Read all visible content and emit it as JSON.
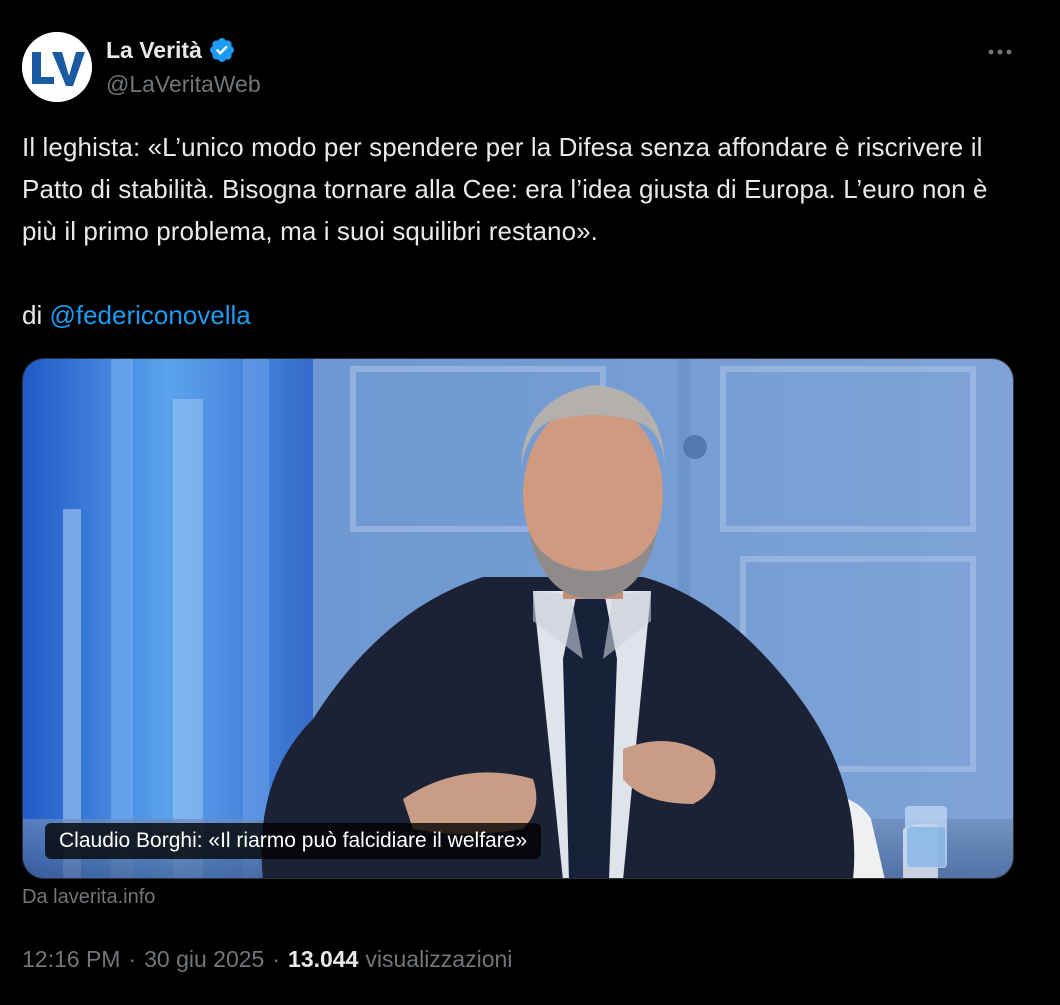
{
  "author": {
    "display_name": "La Verità",
    "handle": "@LaVeritaWeb",
    "avatar_text": "LV",
    "verified": true
  },
  "tweet": {
    "text": "Il leghista: «L’unico modo per spendere per la Difesa senza affondare è riscrivere il Patto di stabilità. Bisogna tornare alla Cee: era l’idea giusta di Europa. L’euro non è più il primo problema, ma i suoi squilibri restano».",
    "byline_prefix": "di",
    "mention": "@federiconovella"
  },
  "card": {
    "caption": "Claudio Borghi: «Il riarmo può falcidiare il welfare»",
    "source": "Da laverita.info"
  },
  "meta": {
    "time": "12:16 PM",
    "separator": "·",
    "date": "30 giu 2025",
    "views_count": "13.044",
    "views_label": "visualizzazioni"
  },
  "icons": {
    "verified": "verified-badge-icon",
    "more": "more-options-icon"
  },
  "colors": {
    "background": "#000000",
    "text": "#e7e9ea",
    "secondary": "#71767b",
    "link": "#1d9bf0"
  }
}
